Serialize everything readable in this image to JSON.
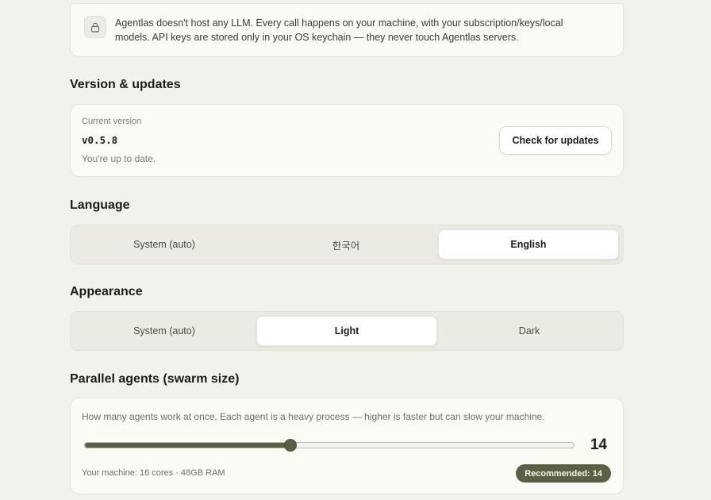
{
  "privacy": {
    "text": "Agentlas doesn't host any LLM. Every call happens on your machine, with your subscription/keys/local models. API keys are stored only in your OS keychain — they never touch Agentlas servers.",
    "icon": "lock-icon"
  },
  "version": {
    "section_title": "Version & updates",
    "current_label": "Current version",
    "value": "v0.5.8",
    "status": "You're up to date.",
    "check_button": "Check for updates"
  },
  "language": {
    "section_title": "Language",
    "options": [
      "System (auto)",
      "한국어",
      "English"
    ],
    "selected": "English"
  },
  "appearance": {
    "section_title": "Appearance",
    "options": [
      "System (auto)",
      "Light",
      "Dark"
    ],
    "selected": "Light"
  },
  "swarm": {
    "section_title": "Parallel agents (swarm size)",
    "description": "How many agents work at once. Each agent is a heavy process — higher is faster but can slow your machine.",
    "value": "14",
    "slider_fraction": 0.42,
    "machine": "Your machine: 16 cores · 48GB RAM",
    "recommended": "Recommended: 14"
  },
  "colors": {
    "accent": "#5b5f43",
    "background": "#f2f2ec",
    "card": "#fbfbf6"
  }
}
